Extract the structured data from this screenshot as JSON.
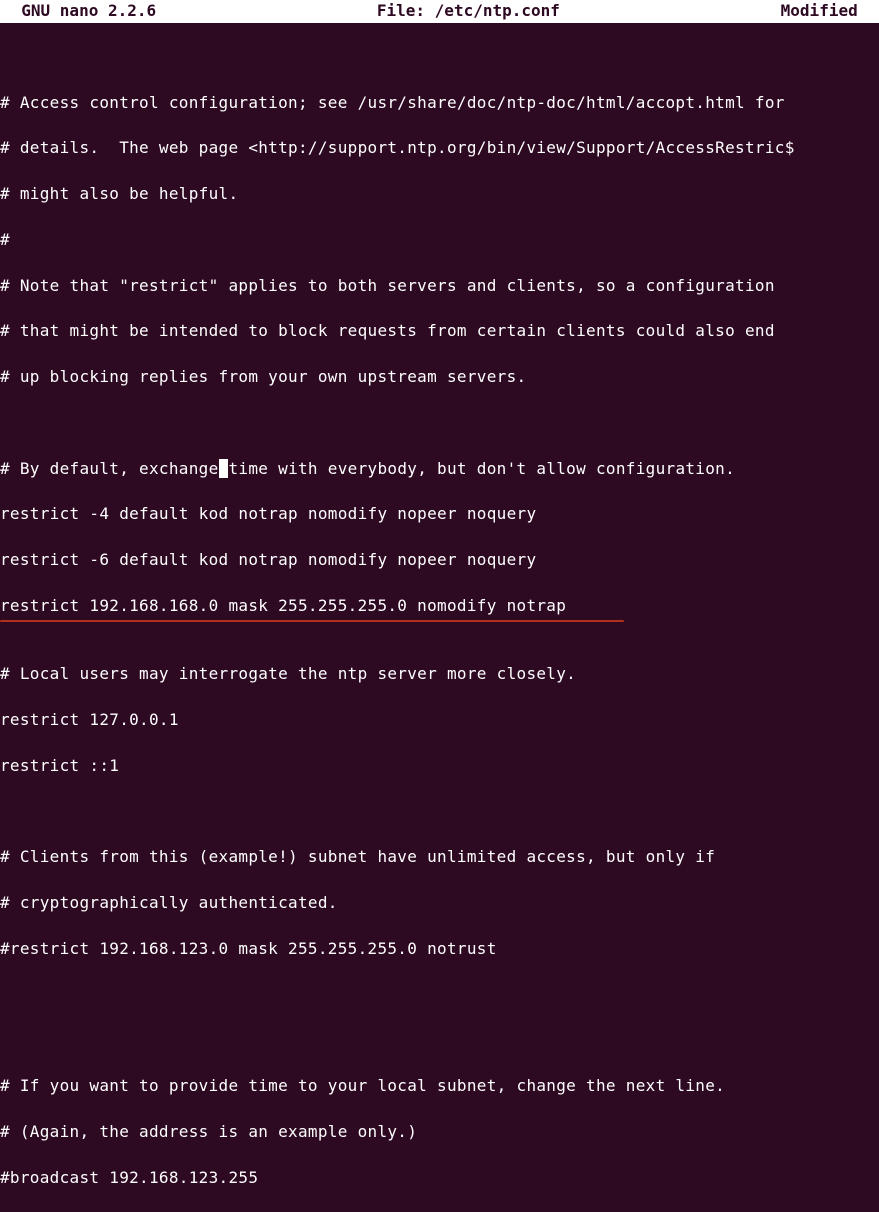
{
  "titlebar": {
    "left": "  GNU nano 2.2.6",
    "center": "File: /etc/ntp.conf",
    "right": "Modified  "
  },
  "lines": {
    "l0": "",
    "l1": "# Access control configuration; see /usr/share/doc/ntp-doc/html/accopt.html for",
    "l2": "# details.  The web page <http://support.ntp.org/bin/view/Support/AccessRestric$",
    "l3": "# might also be helpful.",
    "l4": "#",
    "l5": "# Note that \"restrict\" applies to both servers and clients, so a configuration",
    "l6": "# that might be intended to block requests from certain clients could also end",
    "l7": "# up blocking replies from your own upstream servers.",
    "l8": "",
    "l9a": "# By default, exchange",
    "l9b": " ",
    "l9c": "time with everybody, but don't allow configuration.",
    "l10": "restrict -4 default kod notrap nomodify nopeer noquery",
    "l11": "restrict -6 default kod notrap nomodify nopeer noquery",
    "l12": "restrict 192.168.168.0 mask 255.255.255.0 nomodify notrap",
    "l13": "",
    "l14": "# Local users may interrogate the ntp server more closely.",
    "l15": "restrict 127.0.0.1",
    "l16": "restrict ::1",
    "l17": "",
    "l18": "# Clients from this (example!) subnet have unlimited access, but only if",
    "l19": "# cryptographically authenticated.",
    "l20": "#restrict 192.168.123.0 mask 255.255.255.0 notrust",
    "l21": "",
    "l22": "",
    "l23": "# If you want to provide time to your local subnet, change the next line.",
    "l24": "# (Again, the address is an example only.)",
    "l25": "#broadcast 192.168.123.255"
  }
}
